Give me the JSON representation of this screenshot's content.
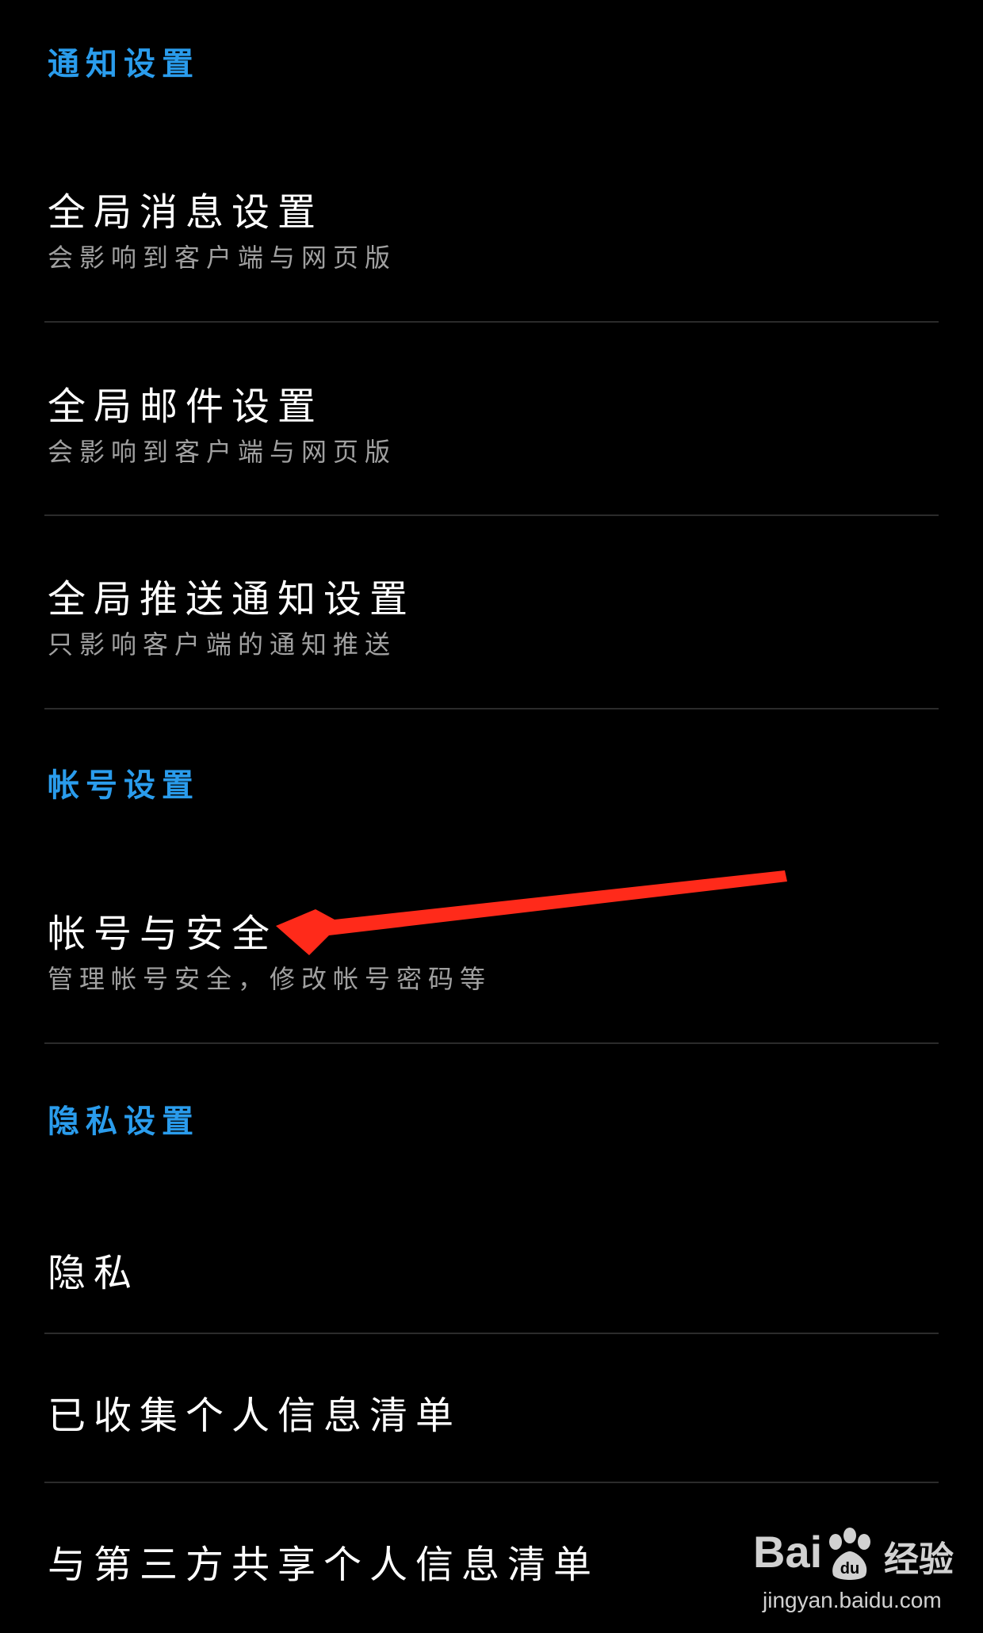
{
  "sections": {
    "notification": {
      "header": "通知设置",
      "items": [
        {
          "title": "全局消息设置",
          "subtitle": "会影响到客户端与网页版"
        },
        {
          "title": "全局邮件设置",
          "subtitle": "会影响到客户端与网页版"
        },
        {
          "title": "全局推送通知设置",
          "subtitle": "只影响客户端的通知推送"
        }
      ]
    },
    "account": {
      "header": "帐号设置",
      "items": [
        {
          "title": "帐号与安全",
          "subtitle": "管理帐号安全，修改帐号密码等"
        }
      ]
    },
    "privacy": {
      "header": "隐私设置",
      "items": [
        {
          "title": "隐私"
        },
        {
          "title": "已收集个人信息清单"
        },
        {
          "title": "与第三方共享个人信息清单"
        }
      ]
    }
  },
  "annotation": {
    "arrow_color": "#ff2a1a",
    "arrow_icon": "red-arrow-icon"
  },
  "watermark": {
    "logo_left": "Bai",
    "logo_right": "经验",
    "url": "jingyan.baidu.com"
  },
  "colors": {
    "background": "#000000",
    "section_header": "#2a9cec",
    "title": "#ffffff",
    "subtitle": "#a0a0a0",
    "divider": "#2b2b2b"
  }
}
